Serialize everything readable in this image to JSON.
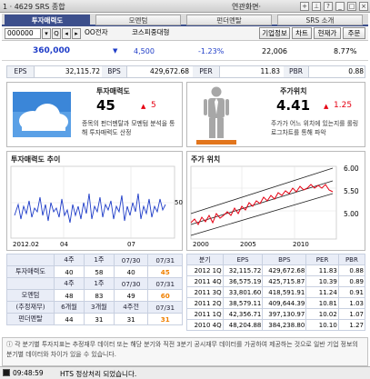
{
  "window": {
    "title": "1 · 4629 SRS 종합",
    "link": "연관화면·"
  },
  "tabs": [
    {
      "label": "투자매력도"
    },
    {
      "label": "모멘텀"
    },
    {
      "label": "펀더멘탈"
    },
    {
      "label": "SRS 소개"
    }
  ],
  "toolbar": {
    "code_value": "000000",
    "stock_name": "OO전자",
    "market_name": "코스피중대형",
    "buttons": [
      "기업정보",
      "차트",
      "현재가",
      "주문"
    ]
  },
  "quote": {
    "price": "360,000",
    "change_arrow": "▼",
    "change": "4,500",
    "change_pct": "-1.23%",
    "volume": "22,006",
    "ratio": "8.77%"
  },
  "metrics": [
    {
      "label": "EPS",
      "value": "32,115.72"
    },
    {
      "label": "BPS",
      "value": "429,672.68"
    },
    {
      "label": "PER",
      "value": "11.83"
    },
    {
      "label": "PBR",
      "value": "0.88"
    }
  ],
  "attractiveness": {
    "title": "투자매력도",
    "score": "45",
    "arrow": "▲",
    "change": "5",
    "desc": "종목의 펀더멘탈과 모멘텀 분석을 통해 투자매력도 산정"
  },
  "price_position": {
    "title": "주가위치",
    "score": "4.41",
    "arrow": "▲",
    "change": "1.25",
    "desc": "주가가 어느 위치에 있는지를 롤링 로그차트를 통해 파악"
  },
  "trend_chart": {
    "title": "투자매력도 추이",
    "x_ticks": [
      "2012.02",
      "04",
      "07"
    ],
    "y_tick": "50"
  },
  "position_chart": {
    "title": "주가 위치",
    "x_ticks": [
      "2000",
      "2005",
      "2010"
    ],
    "y_ticks": [
      "6.00",
      "5.50",
      "5.00"
    ]
  },
  "indicator_table": {
    "groups": [
      {
        "headers": [
          "4주",
          "1주",
          "07/30",
          "07/31"
        ],
        "label": "투자매력도",
        "values": [
          "40",
          "58",
          "40",
          "45"
        ]
      },
      {
        "headers": [
          "4주",
          "1주",
          "07/30",
          "07/31"
        ],
        "label": "모멘텀",
        "values": [
          "48",
          "83",
          "49",
          "60"
        ]
      },
      {
        "headers": [
          "6개월",
          "3개월",
          "4주전",
          "07/31"
        ],
        "label_top": "(추정재무)",
        "label": "펀더멘탈",
        "values": [
          "44",
          "31",
          "31",
          "31"
        ]
      }
    ]
  },
  "financial_table": {
    "headers": [
      "분기",
      "EPS",
      "BPS",
      "PER",
      "PBR"
    ],
    "rows": [
      [
        "2012 1Q",
        "32,115.72",
        "429,672.68",
        "11.83",
        "0.88"
      ],
      [
        "2011 4Q",
        "36,575.19",
        "425,715.87",
        "10.39",
        "0.89"
      ],
      [
        "2011 3Q",
        "33,801.60",
        "418,591.91",
        "11.24",
        "0.91"
      ],
      [
        "2011 2Q",
        "38,579.11",
        "409,644.39",
        "10.81",
        "1.03"
      ],
      [
        "2011 1Q",
        "42,356.71",
        "397,130.97",
        "10.02",
        "1.07"
      ],
      [
        "2010 4Q",
        "48,204.88",
        "384,238.80",
        "10.10",
        "1.27"
      ]
    ]
  },
  "note": "각 분기별 투자지표는 추정재무 데이터 또는 해당 분기와 직전 3분기 공시재무 데이터를 가공하여 제공하는 것으로 일반 기업 정보의 분기별 데이터와 차이가 있을 수 있습니다.",
  "status": {
    "time": "09:48:59",
    "message": "HTS 정상처리 되었습니다."
  },
  "colors": {
    "accent": "#3c4f8c",
    "up": "#e60012",
    "down": "#1e3cc8",
    "highlight": "#f08000"
  }
}
